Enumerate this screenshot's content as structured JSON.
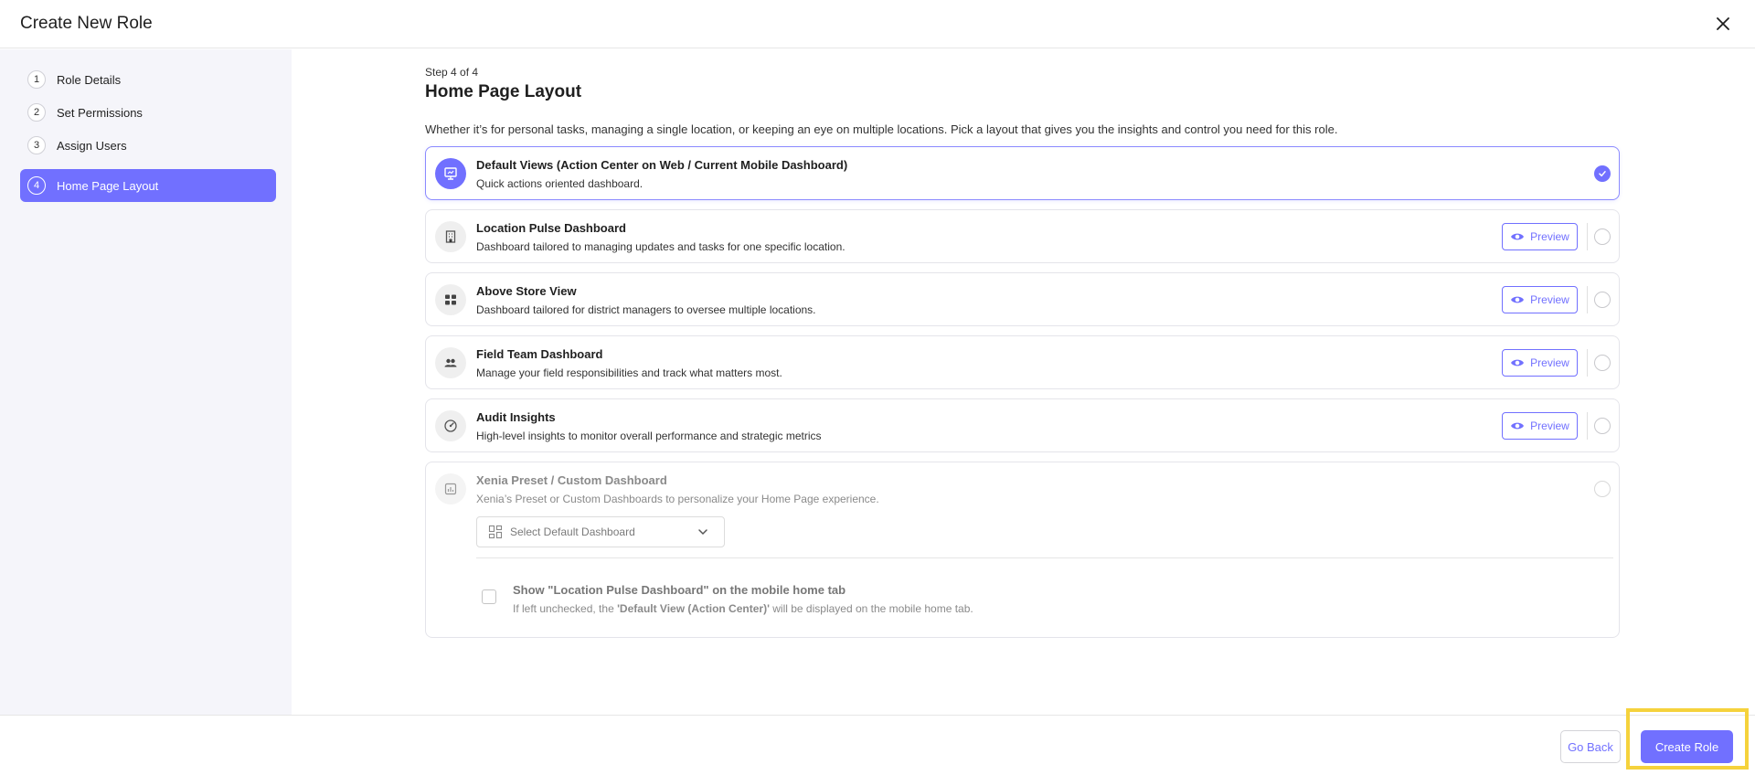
{
  "header": {
    "title": "Create New Role"
  },
  "sidebar": {
    "steps": [
      {
        "num": "1",
        "label": "Role Details"
      },
      {
        "num": "2",
        "label": "Set Permissions"
      },
      {
        "num": "3",
        "label": "Assign Users"
      },
      {
        "num": "4",
        "label": "Home Page Layout"
      }
    ],
    "active_step": 4
  },
  "main": {
    "step_caption": "Step 4 of 4",
    "title": "Home Page Layout",
    "description": "Whether it’s for personal tasks, managing a single location, or keeping an eye on multiple locations. Pick a layout that gives you the insights and control you need for this role.",
    "options": [
      {
        "title": "Default Views (Action Center on Web / Current Mobile Dashboard)",
        "desc": "Quick actions oriented dashboard.",
        "icon": "monitor-icon",
        "selected": true
      },
      {
        "title": "Location Pulse Dashboard",
        "desc": "Dashboard tailored to managing updates and tasks for one specific location.",
        "icon": "building-icon",
        "preview": "Preview"
      },
      {
        "title": "Above Store View",
        "desc": "Dashboard tailored for district managers to oversee multiple locations.",
        "icon": "grid-icon",
        "preview": "Preview"
      },
      {
        "title": "Field Team Dashboard",
        "desc": "Manage your field responsibilities and track what matters most.",
        "icon": "team-icon",
        "preview": "Preview"
      },
      {
        "title": "Audit Insights",
        "desc": "High-level insights to monitor overall performance and strategic metrics",
        "icon": "gauge-icon",
        "preview": "Preview"
      },
      {
        "title": "Xenia Preset / Custom Dashboard",
        "desc": "Xenia’s Preset or Custom Dashboards to personalize your Home Page experience.",
        "icon": "chart-icon",
        "select_placeholder": "Select Default Dashboard",
        "checkbox_title": "Show \"Location Pulse Dashboard\" on the mobile home tab",
        "checkbox_desc_pre": "If left unchecked, the ",
        "checkbox_desc_bold": "'Default View (Action Center)'",
        "checkbox_desc_post": " will be displayed on the mobile home tab."
      }
    ]
  },
  "footer": {
    "go_back": "Go Back",
    "create_role": "Create Role"
  },
  "colors": {
    "accent": "#7170ff",
    "highlight": "#f5d23c",
    "sidebar_bg": "#f5f5fa"
  }
}
